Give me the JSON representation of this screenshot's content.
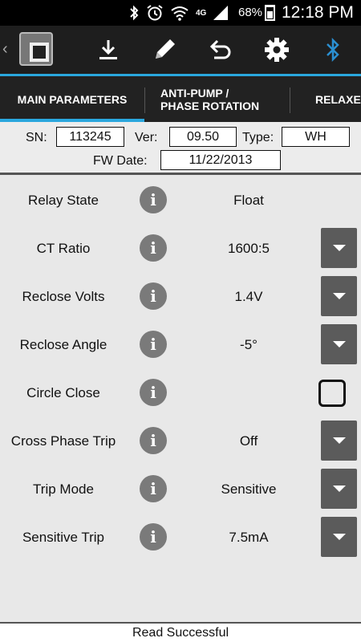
{
  "status_bar": {
    "network": "4G",
    "battery": "68%",
    "time": "12:18 PM",
    "icons": [
      "bluetooth-icon",
      "alarm-icon",
      "wifi-icon",
      "signal-icon",
      "battery-icon"
    ]
  },
  "action_bar": {
    "back": "‹",
    "buttons": [
      "download-icon",
      "edit-pencil-icon",
      "undo-icon",
      "settings-gear-icon",
      "bluetooth-icon"
    ],
    "bluetooth_color": "#2a8fd1"
  },
  "tabs": [
    {
      "label": "MAIN PARAMETERS",
      "active": true
    },
    {
      "label_line1": "ANTI-PUMP /",
      "label_line2": "PHASE ROTATION"
    },
    {
      "label": "RELAXED"
    }
  ],
  "info": {
    "sn_label": "SN:",
    "sn_value": "113245",
    "ver_label": "Ver:",
    "ver_value": "09.50",
    "type_label": "Type:",
    "type_value": "WH",
    "fw_label": "FW Date:",
    "fw_value": "11/22/2013"
  },
  "params": [
    {
      "label": "Relay State",
      "value": "Float",
      "control": "none"
    },
    {
      "label": "CT Ratio",
      "value": "1600:5",
      "control": "dropdown"
    },
    {
      "label": "Reclose Volts",
      "value": "1.4V",
      "control": "dropdown"
    },
    {
      "label": "Reclose Angle",
      "value": "-5°",
      "control": "dropdown"
    },
    {
      "label": "Circle Close",
      "value": "",
      "control": "checkbox",
      "checked": false
    },
    {
      "label": "Cross Phase Trip",
      "value": "Off",
      "control": "dropdown"
    },
    {
      "label": "Trip Mode",
      "value": "Sensitive",
      "control": "dropdown"
    },
    {
      "label": "Sensitive Trip",
      "value": "7.5mA",
      "control": "dropdown"
    }
  ],
  "info_glyph": "i",
  "footer": {
    "status": "Read Successful"
  },
  "colors": {
    "accent": "#2aa7de",
    "actionbar": "#1e1e1e",
    "button": "#5b5b5b"
  }
}
